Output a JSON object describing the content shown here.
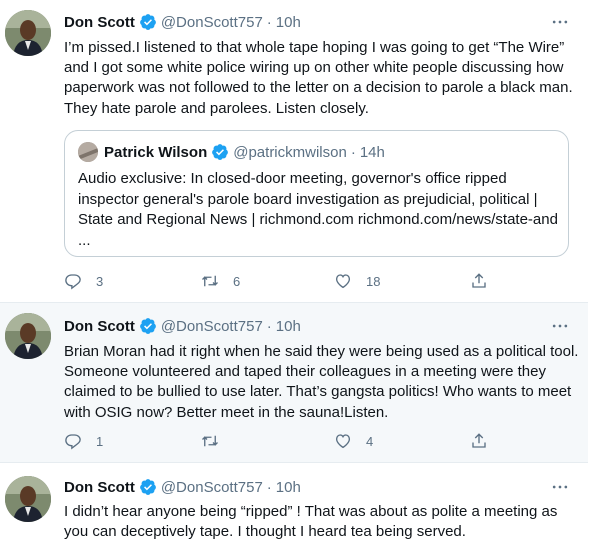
{
  "tweets": [
    {
      "name": "Don Scott",
      "handle": "@DonScott757",
      "separator": "·",
      "time": "10h",
      "text": "I’m pissed.I listened to that whole tape hoping I was going to get “The Wire” and I got some white police wiring up on other white people discussing how paperwork was not followed to the letter on a decision to parole a black man. They hate parole and parolees. Listen closely.",
      "quote": {
        "name": "Patrick Wilson",
        "handle": "@patrickmwilson",
        "separator": "·",
        "time": "14h",
        "text": "Audio exclusive: In closed-door meeting, governor's office ripped inspector general's parole board investigation as prejudicial, political | State and Regional News | richmond.com richmond.com/news/state-and ..."
      },
      "replies": "3",
      "retweets": "6",
      "likes": "18"
    },
    {
      "name": "Don Scott",
      "handle": "@DonScott757",
      "separator": "·",
      "time": "10h",
      "text": "Brian Moran had it right when he said they were being used as a political tool. Someone volunteered and taped their colleagues in a meeting were they claimed to be bullied to use later. That’s gangsta politics! Who wants to meet with OSIG now? Better meet in the sauna!Listen.",
      "replies": "1",
      "retweets": "",
      "likes": "4"
    },
    {
      "name": "Don Scott",
      "handle": "@DonScott757",
      "separator": "·",
      "time": "10h",
      "text": "I didn’t hear anyone being  “ripped” ! That was about as polite a meeting as you can deceptively tape. I thought I heard tea being served."
    }
  ],
  "icons": {
    "verified": "verified-badge-icon",
    "more": "chevron-down-icon",
    "reply": "reply-icon",
    "retweet": "retweet-icon",
    "like": "heart-icon",
    "share": "share-icon"
  },
  "colors": {
    "verified": "#1da1f2",
    "muted": "#5b7083",
    "border": "#c4cfd6",
    "hover_bg": "#f5f8fa"
  }
}
